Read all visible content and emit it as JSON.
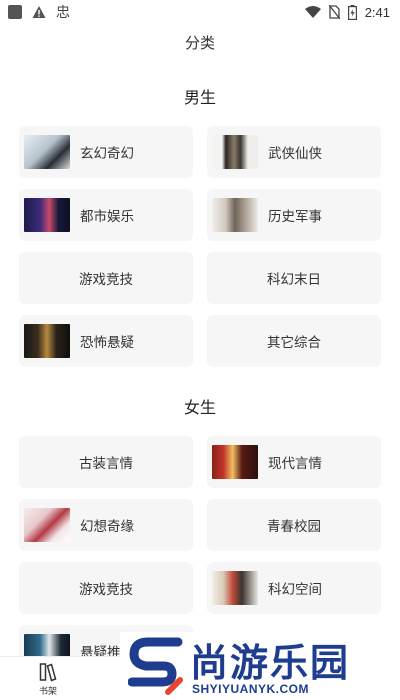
{
  "status_bar": {
    "time": "2:41",
    "app_glyph": "忠",
    "icons": [
      "notification-square-icon",
      "warning-icon",
      "wifi-icon",
      "no-sim-icon",
      "battery-charging-icon"
    ]
  },
  "page": {
    "title": "分类"
  },
  "sections": [
    {
      "title": "男生",
      "items": [
        {
          "label": "玄幻奇幻",
          "has_cover": true
        },
        {
          "label": "武侠仙侠",
          "has_cover": true
        },
        {
          "label": "都市娱乐",
          "has_cover": true
        },
        {
          "label": "历史军事",
          "has_cover": true
        },
        {
          "label": "游戏竞技",
          "has_cover": false
        },
        {
          "label": "科幻末日",
          "has_cover": false
        },
        {
          "label": "恐怖悬疑",
          "has_cover": true
        },
        {
          "label": "其它综合",
          "has_cover": false
        }
      ]
    },
    {
      "title": "女生",
      "items": [
        {
          "label": "古装言情",
          "has_cover": false
        },
        {
          "label": "现代言情",
          "has_cover": true
        },
        {
          "label": "幻想奇缘",
          "has_cover": true
        },
        {
          "label": "青春校园",
          "has_cover": false
        },
        {
          "label": "游戏竞技",
          "has_cover": false
        },
        {
          "label": "科幻空间",
          "has_cover": true
        },
        {
          "label": "悬疑推理",
          "has_cover": true
        }
      ]
    }
  ],
  "tab_bar": {
    "bookshelf_label": "书架"
  },
  "watermark": {
    "brand_cn": "尚游乐园",
    "brand_en": "SHYIYUANYK.COM",
    "color": "#1e3d8f"
  },
  "colors": {
    "card_bg": "#f6f6f6",
    "text": "#333333"
  }
}
